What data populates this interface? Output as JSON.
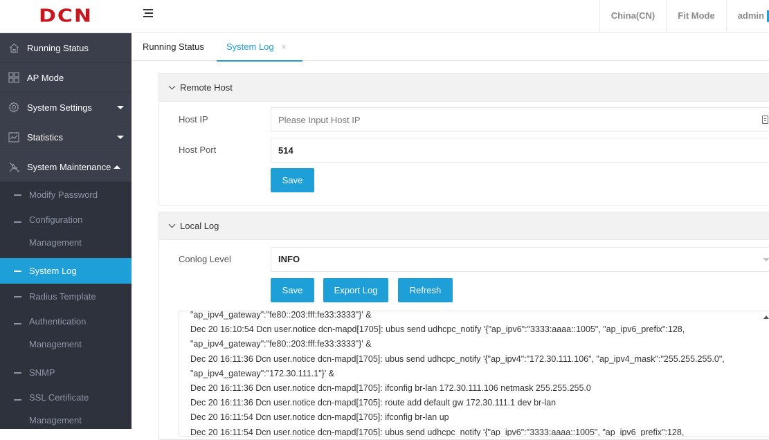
{
  "brand": {
    "logo_text": "DCN",
    "logo_color": "#c8161e"
  },
  "header": {
    "region": "China(CN)",
    "mode": "Fit Mode",
    "user": "admin"
  },
  "sidebar": {
    "items": [
      {
        "label": "Running Status",
        "icon": "home-icon"
      },
      {
        "label": "AP Mode",
        "icon": "grid-icon"
      },
      {
        "label": "System Settings",
        "icon": "gear-icon"
      },
      {
        "label": "Statistics",
        "icon": "chart-icon"
      },
      {
        "label": "System Maintenance",
        "icon": "wrench-icon"
      }
    ],
    "submenu": [
      {
        "label": "Modify Password"
      },
      {
        "label_line1": "Configuration",
        "label_line2": "Management"
      },
      {
        "label": "System Log"
      },
      {
        "label": "Radius Template"
      },
      {
        "label_line1": "Authentication",
        "label_line2": "Management"
      },
      {
        "label": "SNMP"
      },
      {
        "label_line1": "SSL Certificate",
        "label_line2": "Management"
      }
    ]
  },
  "tabs": [
    {
      "label": "Running Status"
    },
    {
      "label": "System Log",
      "close": "×"
    }
  ],
  "remote_host": {
    "title": "Remote Host",
    "host_ip_label": "Host IP",
    "host_ip_placeholder": "Please Input Host IP",
    "host_ip_value": "",
    "host_port_label": "Host Port",
    "host_port_value": "514",
    "save_label": "Save"
  },
  "local_log": {
    "title": "Local Log",
    "level_label": "Conlog Level",
    "level_value": "INFO",
    "save_label": "Save",
    "export_label": "Export Log",
    "refresh_label": "Refresh",
    "lines": [
      "\"ap_ipv4_gateway\":\"fe80::203:fff:fe33:3333\"}' &",
      "Dec 20 16:10:54 Dcn user.notice dcn-mapd[1705]: ubus send udhcpc_notify '{\"ap_ipv6\":\"3333:aaaa::1005\", \"ap_ipv6_prefix\":128,",
      "\"ap_ipv4_gateway\":\"fe80::203:fff:fe33:3333\"}' &",
      "Dec 20 16:11:36 Dcn user.notice dcn-mapd[1705]: ubus send udhcpc_notify '{\"ap_ipv4\":\"172.30.111.106\", \"ap_ipv4_mask\":\"255.255.255.0\",",
      "\"ap_ipv4_gateway\":\"172.30.111.1\"}' &",
      "Dec 20 16:11:36 Dcn user.notice dcn-mapd[1705]: ifconfig br-lan 172.30.111.106 netmask 255.255.255.0",
      "Dec 20 16:11:36 Dcn user.notice dcn-mapd[1705]: route add default gw 172.30.111.1 dev br-lan",
      "Dec 20 16:11:54 Dcn user.notice dcn-mapd[1705]: ifconfig br-lan up",
      "Dec 20 16:11:54 Dcn user.notice dcn-mapd[1705]: ubus send udhcpc_notify '{\"ap_ipv6\":\"3333:aaaa::1005\", \"ap_ipv6_prefix\":128,"
    ]
  },
  "colors": {
    "accent": "#1e9fd8",
    "sidebar_bg": "#3a3f4b",
    "submenu_bg": "#2d323d"
  }
}
